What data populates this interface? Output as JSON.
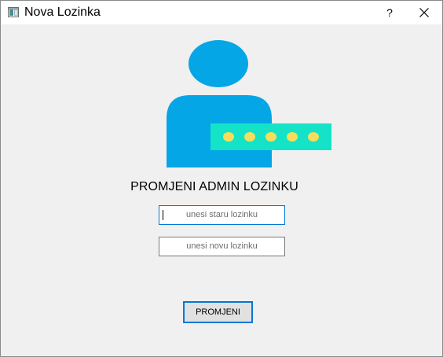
{
  "window": {
    "title": "Nova Lozinka",
    "help_label": "?"
  },
  "illustration": {
    "person_color": "#04a6e6",
    "password_panel_color": "#14e3c8",
    "dot_color": "#f7dd5a",
    "dot_count": 5
  },
  "form": {
    "heading": "PROMJENI ADMIN LOZINKU",
    "old_password_placeholder": "unesi staru lozinku",
    "new_password_placeholder": "unesi novu lozinku",
    "submit_label": "PROMJENI"
  },
  "colors": {
    "window_bg": "#f0f0f0",
    "focus_border": "#0078d7"
  }
}
